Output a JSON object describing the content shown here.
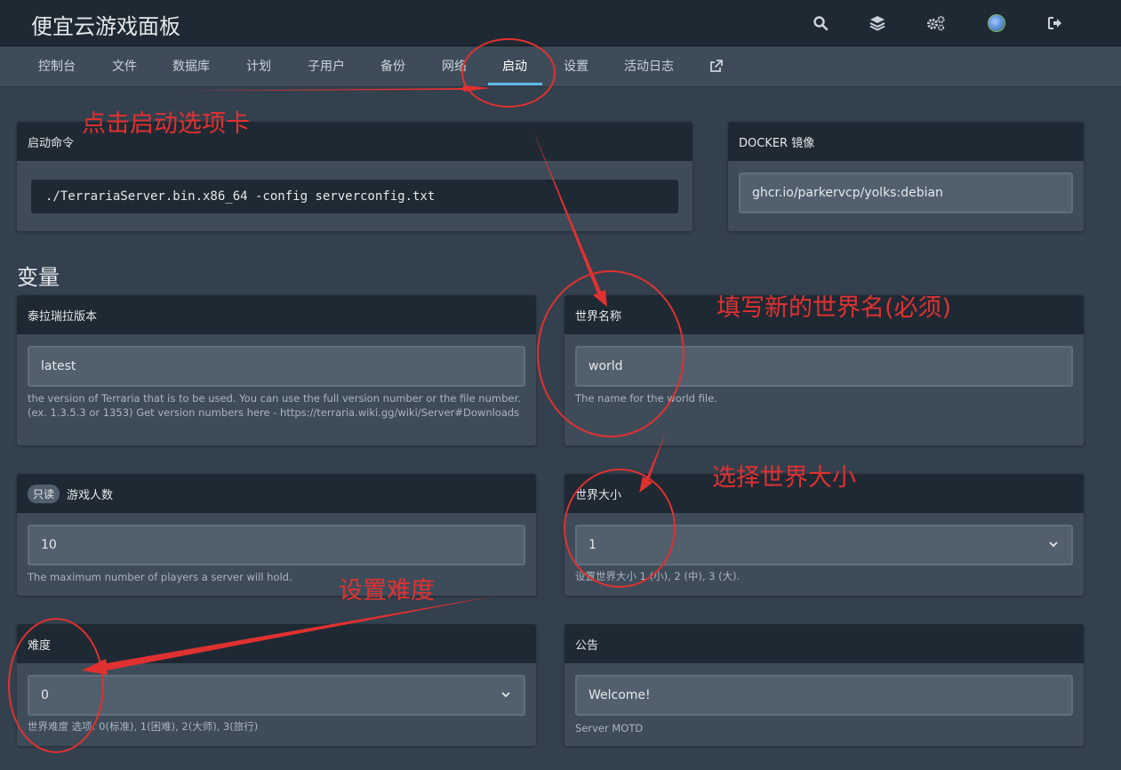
{
  "header": {
    "title": "便宜云游戏面板",
    "icons": [
      "search-icon",
      "layers-icon",
      "gears-icon",
      "avatar",
      "logout-icon"
    ]
  },
  "tabs": [
    {
      "label": "控制台"
    },
    {
      "label": "文件"
    },
    {
      "label": "数据库"
    },
    {
      "label": "计划"
    },
    {
      "label": "子用户"
    },
    {
      "label": "备份"
    },
    {
      "label": "网络"
    },
    {
      "label": "启动",
      "active": true
    },
    {
      "label": "设置"
    },
    {
      "label": "活动日志"
    }
  ],
  "startup": {
    "title": "启动命令",
    "command": "./TerrariaServer.bin.x86_64 -config serverconfig.txt"
  },
  "docker": {
    "title": "DOCKER 镜像",
    "image": "ghcr.io/parkervcp/yolks:debian"
  },
  "variables_title": "变量",
  "variables": {
    "version": {
      "title": "泰拉瑞拉版本",
      "value": "latest",
      "description": "the version of Terraria that is to be used. You can use the full version number or the file number. (ex. 1.3.5.3 or 1353) Get version numbers here - https://terraria.wiki.gg/wiki/Server#Downloads"
    },
    "world_name": {
      "title": "世界名称",
      "value": "world",
      "description": "The name for the world file."
    },
    "max_players": {
      "badge": "只读",
      "title": "游戏人数",
      "value": "10",
      "description": "The maximum number of players a server will hold."
    },
    "world_size": {
      "title": "世界大小",
      "value": "1",
      "description": "设置世界大小 1 (小), 2 (中), 3 (大)."
    },
    "difficulty": {
      "title": "难度",
      "value": "0",
      "description": "世界难度 选项: 0(标准), 1(困难), 2(大师), 3(旅行)"
    },
    "motd": {
      "title": "公告",
      "value": "Welcome!",
      "description": "Server MOTD"
    }
  },
  "annotations": {
    "click_tab": "点击启动选项卡",
    "world_name": "填写新的世界名(必须)",
    "world_size": "选择世界大小",
    "difficulty": "设置难度",
    "color": "#e03131"
  },
  "colors": {
    "header_bg": "#1f2933",
    "page_bg": "#33404d",
    "card_bg": "#3e4c59",
    "accent": "#5fb7e8"
  }
}
